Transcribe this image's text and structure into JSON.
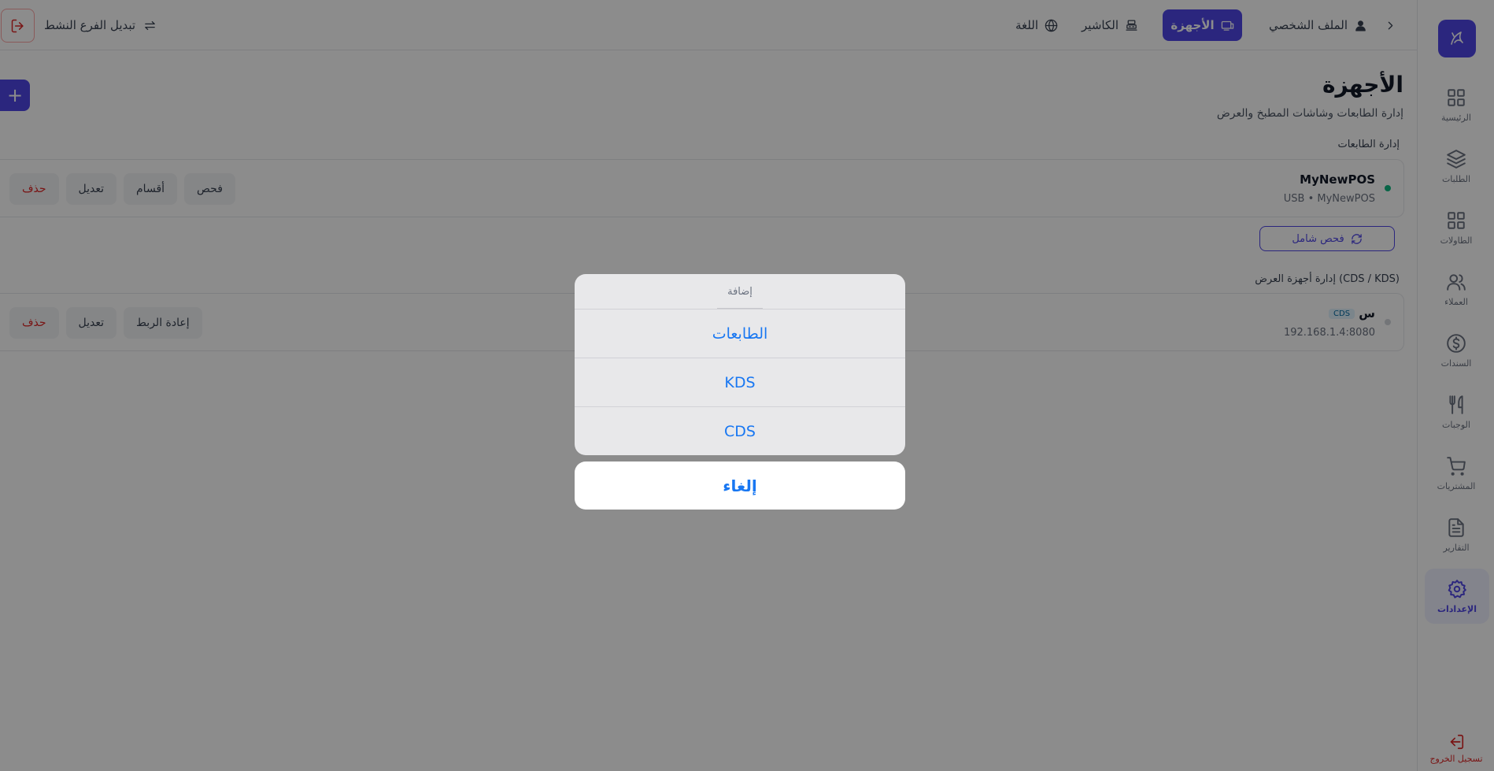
{
  "sidebar": {
    "items": [
      {
        "label": "الرئيسية",
        "icon": "grid-icon"
      },
      {
        "label": "الطلبات",
        "icon": "layers-icon"
      },
      {
        "label": "الطاولات",
        "icon": "grid-icon"
      },
      {
        "label": "العملاء",
        "icon": "users-icon"
      },
      {
        "label": "السندات",
        "icon": "dollar-icon"
      },
      {
        "label": "الوجبات",
        "icon": "utensils-icon"
      },
      {
        "label": "المشتريات",
        "icon": "cart-icon"
      },
      {
        "label": "التقارير",
        "icon": "document-icon"
      },
      {
        "label": "الإعدادات",
        "icon": "gear-icon",
        "active": true
      }
    ],
    "logout_label": "تسجيل الخروج"
  },
  "topbar": {
    "profile": "الملف الشخصي",
    "devices": "الأجهزة",
    "cashier": "الكاشير",
    "language": "اللغة",
    "switch_branch": "تبديل الفرع النشط"
  },
  "page": {
    "title": "الأجهزة",
    "subtitle": "إدارة الطابعات وشاشات المطبخ والعرض"
  },
  "printers": {
    "section_label": "إدارة الطابعات",
    "items": [
      {
        "name": "MyNewPOS",
        "detail": "USB • MyNewPOS",
        "status_color": "#10b981"
      }
    ],
    "actions": {
      "scan": "فحص",
      "sections": "أقسام",
      "edit": "تعديل",
      "delete": "حذف"
    },
    "scan_all": "فحص شامل"
  },
  "displays": {
    "section_label": "إدارة أجهزة العرض (CDS / KDS)",
    "items": [
      {
        "name": "س",
        "badge": "CDS",
        "detail": "192.168.1.4:8080",
        "status_color": "#d1d5db"
      }
    ],
    "actions": {
      "reconnect": "إعادة الربط",
      "edit": "تعديل",
      "delete": "حذف"
    }
  },
  "action_sheet": {
    "title": "إضافة",
    "options": [
      "الطابعات",
      "KDS",
      "CDS"
    ],
    "cancel": "إلغاء"
  },
  "colors": {
    "accent": "#4f46e5",
    "danger": "#dc2626",
    "ios_blue": "#1877f2"
  }
}
